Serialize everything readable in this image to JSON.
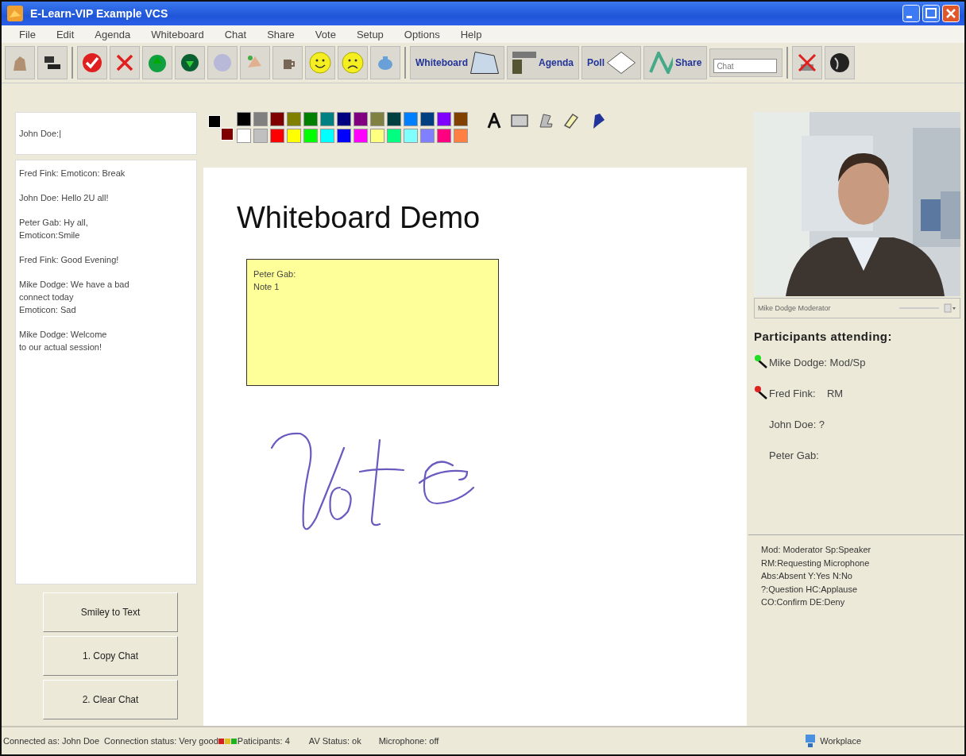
{
  "window": {
    "title": "E-Learn-VIP Example VCS"
  },
  "menu": [
    "File",
    "Edit",
    "Agenda",
    "Whiteboard",
    "Chat",
    "Share",
    "Vote",
    "Setup",
    "Options",
    "Help"
  ],
  "toolbar": {
    "labeled_buttons": [
      {
        "label": "Whiteboard"
      },
      {
        "label": "Agenda"
      },
      {
        "label": "Poll"
      },
      {
        "label": "Share"
      }
    ],
    "chat_field": {
      "value": "Chat"
    }
  },
  "chat": {
    "input_value": "John Doe:|",
    "messages": [
      "Fred Fink: Emoticon: Break",
      "John Doe: Hello 2U all!",
      "Peter Gab: Hy all,\nEmoticon:Smile",
      "Fred Fink: Good Evening!",
      "Mike Dodge: We have a bad\nconnect today\nEmoticon: Sad",
      "Mike Dodge: Welcome\nto our actual session!"
    ],
    "buttons": [
      "Smiley to Text",
      "1. Copy Chat",
      "2. Clear Chat"
    ]
  },
  "palette": {
    "current_colors": [
      {
        "color": "#000000"
      },
      {
        "color": "#800000"
      }
    ],
    "colors": [
      {
        "color": "#000000"
      },
      {
        "color": "#808080"
      },
      {
        "color": "#800000"
      },
      {
        "color": "#808000"
      },
      {
        "color": "#008000"
      },
      {
        "color": "#008080"
      },
      {
        "color": "#000080"
      },
      {
        "color": "#800080"
      },
      {
        "color": "#808040"
      },
      {
        "color": "#004040"
      },
      {
        "color": "#0080ff"
      },
      {
        "color": "#004080"
      },
      {
        "color": "#8000ff"
      },
      {
        "color": "#804000"
      },
      {
        "color": "#ffffff"
      },
      {
        "color": "#c0c0c0"
      },
      {
        "color": "#ff0000"
      },
      {
        "color": "#ffff00"
      },
      {
        "color": "#00ff00"
      },
      {
        "color": "#00ffff"
      },
      {
        "color": "#0000ff"
      },
      {
        "color": "#ff00ff"
      },
      {
        "color": "#ffff80"
      },
      {
        "color": "#00ff80"
      },
      {
        "color": "#80ffff"
      },
      {
        "color": "#8080ff"
      },
      {
        "color": "#ff0080"
      },
      {
        "color": "#ff8040"
      }
    ]
  },
  "whiteboard": {
    "title": "Whiteboard Demo",
    "note": "Peter Gab:\nNote 1"
  },
  "video": {
    "caption": "Mike Dodge Moderator"
  },
  "participants": {
    "heading": "Participants attending:",
    "items": [
      {
        "name": "Mike Dodge: Mod/Sp",
        "color": "#22dd22"
      },
      {
        "name": "Fred Fink:    RM",
        "color": "#dd2222"
      },
      {
        "name": "John Doe: ?"
      },
      {
        "name": "Peter Gab:"
      }
    ],
    "legend": [
      "Mod: Moderator Sp:Speaker",
      "RM:Requesting Microphone",
      "Abs:Absent Y:Yes N:No",
      "?:Question HC:Applause",
      "CO:Confirm DE:Deny"
    ]
  },
  "status_bar": {
    "connected": "Connected as: John Doe",
    "connection": "Connection status: Very good",
    "participants": "Paticipants: 4",
    "av": "AV Status: ok",
    "microphone": "Microphone: off",
    "workplace": "Workplace"
  }
}
